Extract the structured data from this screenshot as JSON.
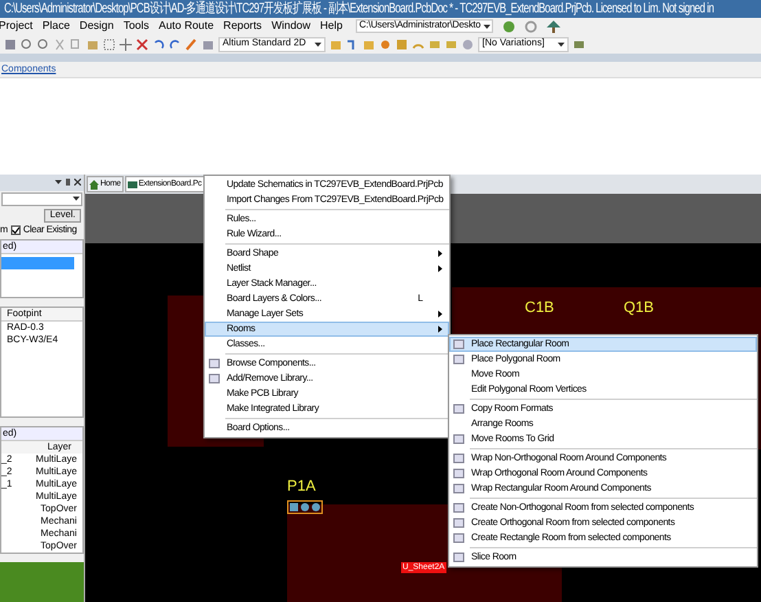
{
  "window": {
    "title": "C:\\Users\\Administrator\\Desktop\\PCB设计\\AD-多通道设计\\TC297开发板扩展板 - 副本\\ExtensionBoard.PcbDoc * - TC297EVB_ExtendBoard.PrjPcb. Licensed to Lim. Not signed in"
  },
  "menu_bar": {
    "items": [
      "Project",
      "Place",
      "Design",
      "Tools",
      "Auto Route",
      "Reports",
      "Window",
      "Help"
    ],
    "path_field": "C:\\Users\\Administrator\\Deskto"
  },
  "toolbar": {
    "view_dropdown": "Altium Standard 2D",
    "variant_dropdown": "[No Variations]"
  },
  "breadcrumb": "Components",
  "left_panel": {
    "level_button": "Level.",
    "checkbox_prefix": "m",
    "clear_existing": {
      "label": "Clear Existing",
      "checked": true
    },
    "list_header": "ed)",
    "component_table": {
      "columns": [
        "Footpint"
      ],
      "rows": [
        "RAD-0.3",
        "BCY-W3/E4"
      ]
    },
    "primitive_table": {
      "header": "ed)",
      "columns": [
        "Layer"
      ],
      "rows": [
        {
          "column_1": "_2",
          "layer": "MultiLaye"
        },
        {
          "column_1": "_2",
          "layer": "MultiLaye"
        },
        {
          "column_1": "_1",
          "layer": "MultiLaye"
        },
        {
          "layer": "MultiLaye"
        },
        {
          "layer": "TopOver"
        },
        {
          "layer": "Mechani"
        },
        {
          "layer": "Mechani"
        },
        {
          "layer": "TopOver"
        }
      ]
    }
  },
  "document_tabs": [
    {
      "label": "Home",
      "selected": false
    },
    {
      "label": "ExtensionBoard.Pc",
      "selected": true
    }
  ],
  "canvas": {
    "designators": [
      "C1B",
      "Q1B",
      "P1A"
    ],
    "room_label": "U_Sheet2A"
  },
  "design_menu": {
    "groups": [
      [
        {
          "label": "Update Schematics in TC297EVB_ExtendBoard.PrjPcb",
          "selected": false
        },
        {
          "label": "Import Changes From TC297EVB_ExtendBoard.PrjPcb",
          "selected": false
        }
      ],
      [
        {
          "label": "Rules...",
          "selected": false
        },
        {
          "label": "Rule Wizard...",
          "selected": false
        }
      ],
      [
        {
          "label": "Board Shape",
          "submenu": true,
          "selected": false
        },
        {
          "label": "Netlist",
          "submenu": true,
          "selected": false
        },
        {
          "label": "Layer Stack Manager...",
          "selected": false
        },
        {
          "label": "Board Layers & Colors...",
          "shortcut": "L",
          "selected": false
        },
        {
          "label": "Manage Layer Sets",
          "submenu": true,
          "selected": false
        },
        {
          "label": "Rooms",
          "submenu": true,
          "selected": true
        },
        {
          "label": "Classes...",
          "selected": false
        }
      ],
      [
        {
          "label": "Browse Components...",
          "icon": true,
          "selected": false
        },
        {
          "label": "Add/Remove Library...",
          "icon": true,
          "selected": false
        },
        {
          "label": "Make PCB Library",
          "selected": false
        },
        {
          "label": "Make Integrated Library",
          "selected": false
        }
      ],
      [
        {
          "label": "Board Options...",
          "selected": false
        }
      ]
    ]
  },
  "rooms_submenu": {
    "groups": [
      [
        {
          "label": "Place Rectangular Room",
          "icon": true,
          "selected": true
        },
        {
          "label": "Place Polygonal Room",
          "icon": true,
          "selected": false
        },
        {
          "label": "Move Room",
          "selected": false
        },
        {
          "label": "Edit Polygonal Room Vertices",
          "selected": false
        }
      ],
      [
        {
          "label": "Copy Room Formats",
          "icon": true,
          "selected": false
        },
        {
          "label": "Arrange Rooms",
          "selected": false
        },
        {
          "label": "Move Rooms To Grid",
          "icon": true,
          "selected": false
        }
      ],
      [
        {
          "label": "Wrap Non-Orthogonal Room Around Components",
          "icon": true,
          "selected": false
        },
        {
          "label": "Wrap Orthogonal Room Around Components",
          "icon": true,
          "selected": false
        },
        {
          "label": "Wrap Rectangular Room Around Components",
          "icon": true,
          "selected": false
        }
      ],
      [
        {
          "label": "Create Non-Orthogonal Room from selected components",
          "icon": true,
          "selected": false
        },
        {
          "label": "Create Orthogonal Room from selected components",
          "icon": true,
          "selected": false
        },
        {
          "label": "Create Rectangle Room from selected components",
          "icon": true,
          "selected": false
        }
      ],
      [
        {
          "label": "Slice Room",
          "icon": true,
          "selected": false
        }
      ]
    ]
  }
}
